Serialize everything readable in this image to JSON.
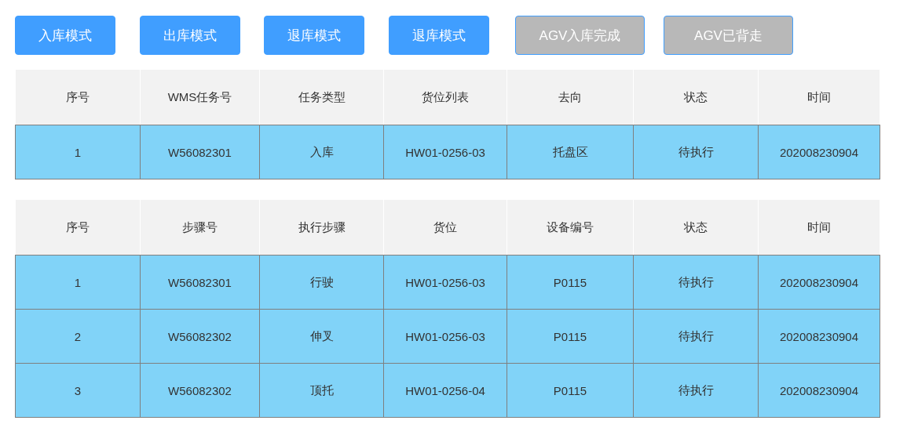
{
  "buttons": [
    {
      "label": "入库模式",
      "disabled": false
    },
    {
      "label": "出库模式",
      "disabled": false
    },
    {
      "label": "退库模式",
      "disabled": false
    },
    {
      "label": "退库模式",
      "disabled": false
    },
    {
      "label": "AGV入库完成",
      "disabled": true
    },
    {
      "label": "AGV已背走",
      "disabled": true
    }
  ],
  "task_table": {
    "columns": [
      "序号",
      "WMS任务号",
      "任务类型",
      "货位列表",
      "去向",
      "状态",
      "时间"
    ],
    "rows": [
      [
        "1",
        "W56082301",
        "入库",
        "HW01-0256-03",
        "托盘区",
        "待执行",
        "202008230904"
      ]
    ]
  },
  "step_table": {
    "columns": [
      "序号",
      "步骤号",
      "执行步骤",
      "货位",
      "设备编号",
      "状态",
      "时间"
    ],
    "rows": [
      [
        "1",
        "W56082301",
        "行驶",
        "HW01-0256-03",
        "P0115",
        "待执行",
        "202008230904"
      ],
      [
        "2",
        "W56082302",
        "伸叉",
        "HW01-0256-03",
        "P0115",
        "待执行",
        "202008230904"
      ],
      [
        "3",
        "W56082302",
        "顶托",
        "HW01-0256-04",
        "P0115",
        "待执行",
        "202008230904"
      ]
    ]
  }
}
